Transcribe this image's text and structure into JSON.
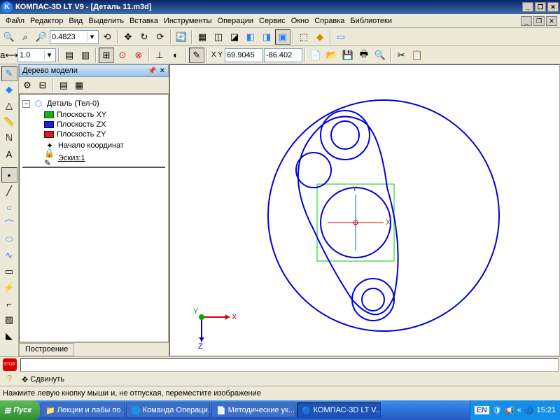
{
  "titlebar": {
    "app_icon_letter": "K",
    "title": "КОМПАС-3D LT V9 - [Деталь 11.m3d]"
  },
  "menubar": {
    "items": [
      "Файл",
      "Редактор",
      "Вид",
      "Выделить",
      "Вставка",
      "Инструменты",
      "Операции",
      "Сервис",
      "Окно",
      "Справка",
      "Библиотеки"
    ]
  },
  "toolbar1": {
    "zoom_value": "0.4823"
  },
  "toolbar2": {
    "scale_value": "1.0",
    "coord_x": "69.9045",
    "coord_y": "-86.402",
    "xy_label": "X Y"
  },
  "tree": {
    "title": "Дерево модели",
    "root": "Деталь (Тел-0)",
    "items": [
      {
        "icon": "plane-xy",
        "label": "Плоскость XY",
        "color": "#22aa22"
      },
      {
        "icon": "plane-zx",
        "label": "Плоскость ZX",
        "color": "#2222cc"
      },
      {
        "icon": "plane-zy",
        "label": "Плоскость ZY",
        "color": "#cc2222"
      },
      {
        "icon": "origin",
        "label": "Начало координат",
        "color": "#000"
      },
      {
        "icon": "sketch",
        "label": "Эскиз:1",
        "color": "#555"
      }
    ],
    "tab": "Построение"
  },
  "viewport": {
    "axis_x": "X",
    "axis_y": "Y",
    "axis_z": "Z"
  },
  "bottom": {
    "stop": "STOP",
    "move_label": "Сдвинуть"
  },
  "statusbar": {
    "text": "Нажмите левую кнопку мыши и, не отпуская, переместите изображение"
  },
  "taskbar": {
    "start": "Пуск",
    "items": [
      {
        "icon": "📁",
        "label": "Лекции и лабы по ..."
      },
      {
        "icon": "🌐",
        "label": "Команда Операци..."
      },
      {
        "icon": "📄",
        "label": "Методические ук..."
      },
      {
        "icon": "🔵",
        "label": "КОМПАС-3D LT V..."
      }
    ],
    "lang": "EN",
    "time": "15:21"
  }
}
